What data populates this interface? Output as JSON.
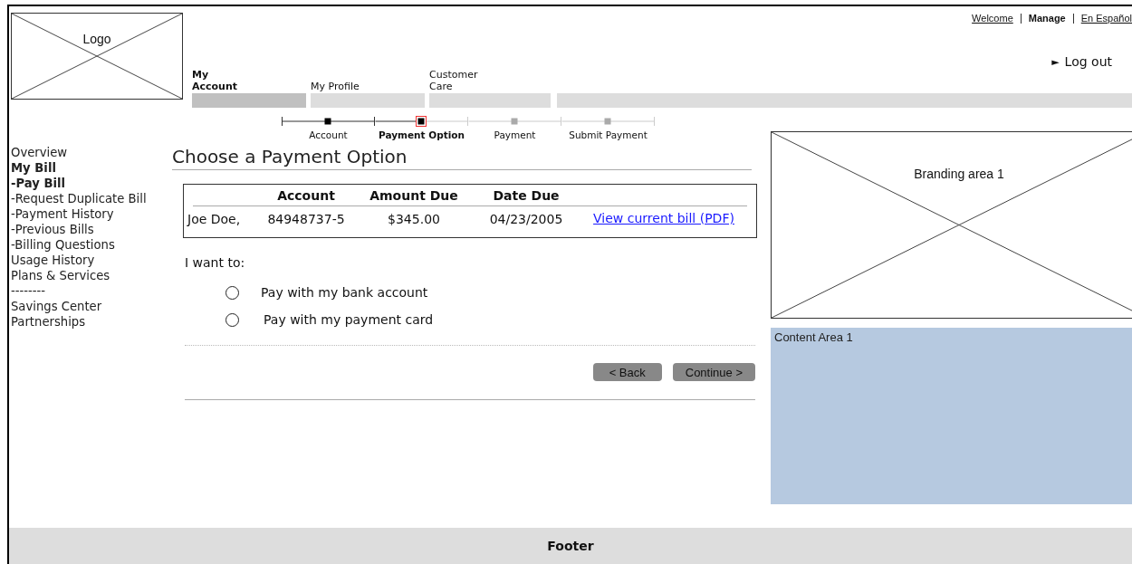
{
  "header": {
    "logo": "Logo",
    "top_links": [
      {
        "label": "Welcome",
        "kind": "link"
      },
      {
        "label": "Manage",
        "kind": "current"
      },
      {
        "label": "En Español",
        "kind": "link"
      }
    ],
    "tabs": [
      {
        "label": "My Account",
        "selected": true
      },
      {
        "label": "My Profile",
        "selected": false
      },
      {
        "label": "Customer Care",
        "selected": false
      }
    ],
    "logout": {
      "icon": "►",
      "label": "Log out"
    }
  },
  "steps": [
    {
      "label": "Account",
      "completed": true,
      "selected": false
    },
    {
      "label": "Payment Option",
      "completed": false,
      "selected": true
    },
    {
      "label": "Payment",
      "completed": false,
      "selected": false
    },
    {
      "label": "Submit Payment",
      "completed": false,
      "selected": false
    }
  ],
  "sidebar": {
    "items": [
      {
        "label": "Overview",
        "active": false
      },
      {
        "label": "My Bill",
        "active": true
      },
      {
        "label": "-Pay Bill",
        "active": true
      },
      {
        "label": "-Request Duplicate Bill",
        "active": false
      },
      {
        "label": "-Payment History",
        "active": false
      },
      {
        "label": "-Previous Bills",
        "active": false
      },
      {
        "label": "-Billing Questions",
        "active": false
      },
      {
        "label": "Usage History",
        "active": false
      },
      {
        "label": "Plans & Services",
        "active": false
      },
      {
        "label": "--------",
        "active": false
      },
      {
        "label": "Savings Center",
        "active": false
      },
      {
        "label": "Partnerships",
        "active": false
      }
    ]
  },
  "main": {
    "title": "Choose a Payment Option",
    "table": {
      "columns": [
        "",
        "Account",
        "Amount Due",
        "Date Due"
      ],
      "rows": [
        {
          "cells": [
            "Joe Doe,",
            "84948737-5",
            "$345.00",
            "04/23/2005"
          ],
          "link": "View current bill (PDF)"
        }
      ]
    },
    "prompt": "I want to:",
    "options": [
      {
        "label": "Pay with my bank account",
        "selected": false
      },
      {
        "label": "Pay with my payment card",
        "selected": false
      }
    ],
    "buttons": [
      "< Back",
      "Continue >"
    ]
  },
  "right": {
    "branding": "Branding area 1",
    "content": "Content Area 1"
  },
  "footer": "Footer"
}
